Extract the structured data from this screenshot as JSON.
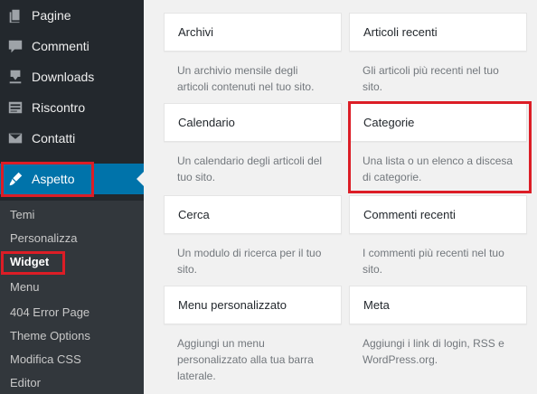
{
  "sidebar": {
    "menu": [
      {
        "label": "Pagine",
        "icon": "pages-icon"
      },
      {
        "label": "Commenti",
        "icon": "comments-icon"
      },
      {
        "label": "Downloads",
        "icon": "download-icon"
      },
      {
        "label": "Riscontro",
        "icon": "feedback-icon"
      },
      {
        "label": "Contatti",
        "icon": "mail-icon"
      },
      {
        "label": "Aspetto",
        "icon": "brush-icon"
      }
    ],
    "submenu": [
      "Temi",
      "Personalizza",
      "Widget",
      "Menu",
      "404 Error Page",
      "Theme Options",
      "Modifica CSS",
      "Editor"
    ]
  },
  "widgets": [
    {
      "title": "Archivi",
      "desc": "Un archivio mensile degli articoli contenuti nel tuo sito."
    },
    {
      "title": "Articoli recenti",
      "desc": "Gli articoli più recenti nel tuo sito."
    },
    {
      "title": "Calendario",
      "desc": "Un calendario degli articoli del tuo sito."
    },
    {
      "title": "Categorie",
      "desc": "Una lista o un elenco a discesa di categorie."
    },
    {
      "title": "Cerca",
      "desc": "Un modulo di ricerca per il tuo sito."
    },
    {
      "title": "Commenti recenti",
      "desc": "I commenti più recenti nel tuo sito."
    },
    {
      "title": "Menu personalizzato",
      "desc": "Aggiungi un menu personalizzato alla tua barra laterale."
    },
    {
      "title": "Meta",
      "desc": "Aggiungi i link di login, RSS e WordPress.org."
    }
  ],
  "colors": {
    "sidebar": "#23282d",
    "submenu": "#32373c",
    "accent": "#0073aa",
    "highlight": "#dc1d26"
  }
}
